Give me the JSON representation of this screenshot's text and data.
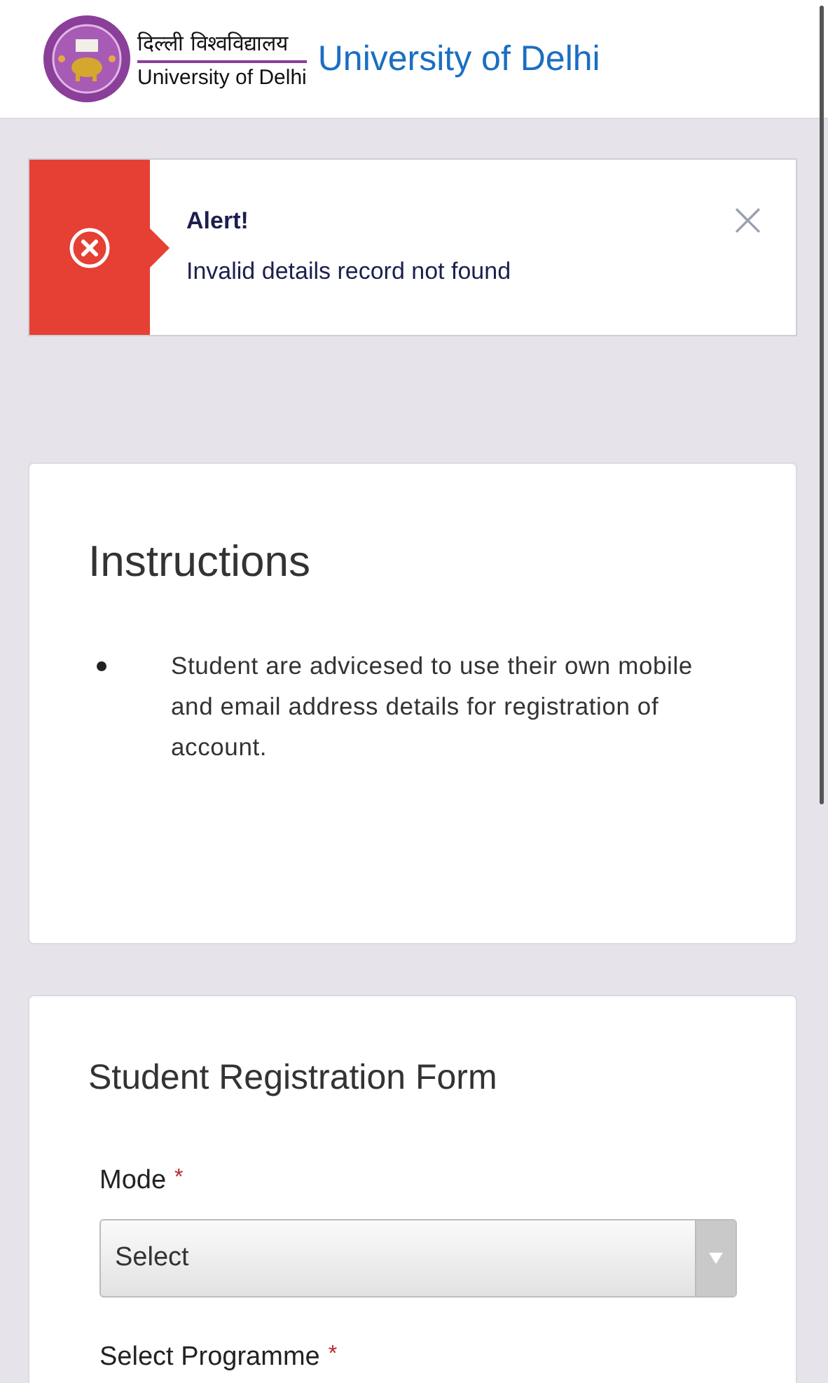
{
  "header": {
    "logo_hindi": "दिल्ली विश्वविद्यालय",
    "logo_english": "University of Delhi",
    "title": "University of Delhi"
  },
  "alert": {
    "title": "Alert!",
    "message": "Invalid details record not found",
    "close": "×"
  },
  "instructions": {
    "heading": "Instructions",
    "items": [
      "Student are advicesed to use their own mobile and email address details for registration of account."
    ]
  },
  "form": {
    "heading": "Student Registration Form",
    "fields": [
      {
        "kind": "select",
        "label": "Mode",
        "required_mark": "*",
        "value": "Select"
      },
      {
        "kind": "label_only",
        "label": "Select Programme",
        "required_mark": "*"
      }
    ]
  }
}
